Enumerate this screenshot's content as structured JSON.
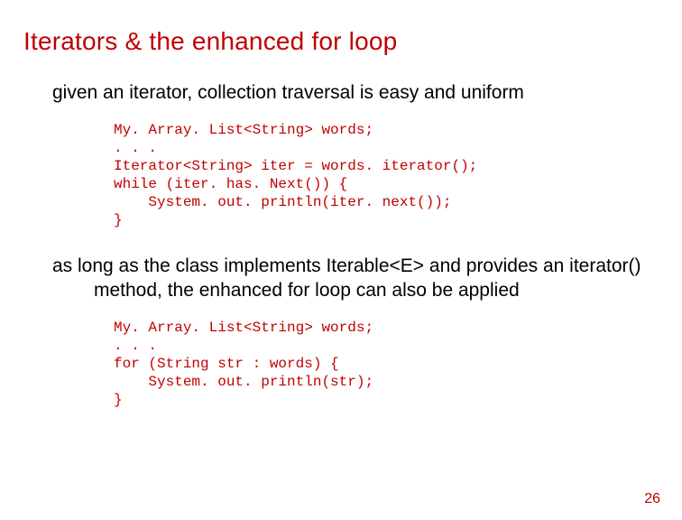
{
  "title": "Iterators & the enhanced for loop",
  "para1": "given an iterator, collection traversal is easy and uniform",
  "code1": "My. Array. List<String> words;\n. . .\nIterator<String> iter = words. iterator();\nwhile (iter. has. Next()) {\n    System. out. println(iter. next());\n}",
  "para2": "as long as the class implements Iterable<E> and provides an iterator() method, the enhanced for loop can also be applied",
  "code2": "My. Array. List<String> words;\n. . .\nfor (String str : words) {\n    System. out. println(str);\n}",
  "page_number": "26"
}
